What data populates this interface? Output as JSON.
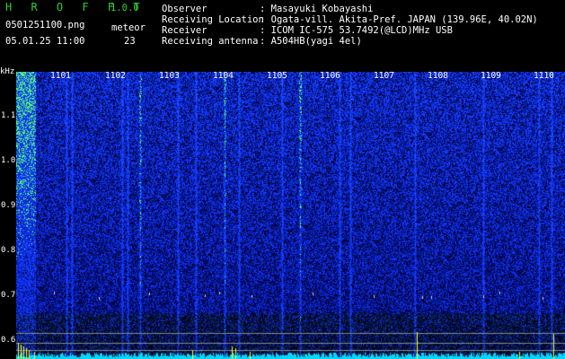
{
  "header": {
    "app_name": "H R O F F T",
    "version": "1.0.0",
    "filename": "0501251100.png",
    "datetime": "05.01.25 11:00",
    "meteor_label": "meteor",
    "meteor_count": "23",
    "info": [
      {
        "label": "Observer",
        "value": ": Masayuki Kobayashi"
      },
      {
        "label": "Receiving Location",
        "value": ": Ogata-vill. Akita-Pref. JAPAN (139.96E, 40.02N)"
      },
      {
        "label": "Receiver",
        "value": ": ICOM IC-575 53.7492(@LCD)MHz USB"
      },
      {
        "label": "Receiving antenna",
        "value": ": A504HB(yagi 4el)"
      }
    ]
  },
  "spectrogram": {
    "y_unit": "kHz",
    "y_ticks": [
      "1.1",
      "1.0",
      "0.9",
      "0.8",
      "0.7",
      "0.6"
    ],
    "x_ticks": [
      "1101",
      "1102",
      "1103",
      "1104",
      "1105",
      "1106",
      "1107",
      "1108",
      "1109",
      "1110"
    ],
    "colors": {
      "background": "#000022",
      "noise": "#1a3cff",
      "signal": "#00ff66",
      "level": "#00ffff",
      "spike": "#ffff00"
    }
  }
}
